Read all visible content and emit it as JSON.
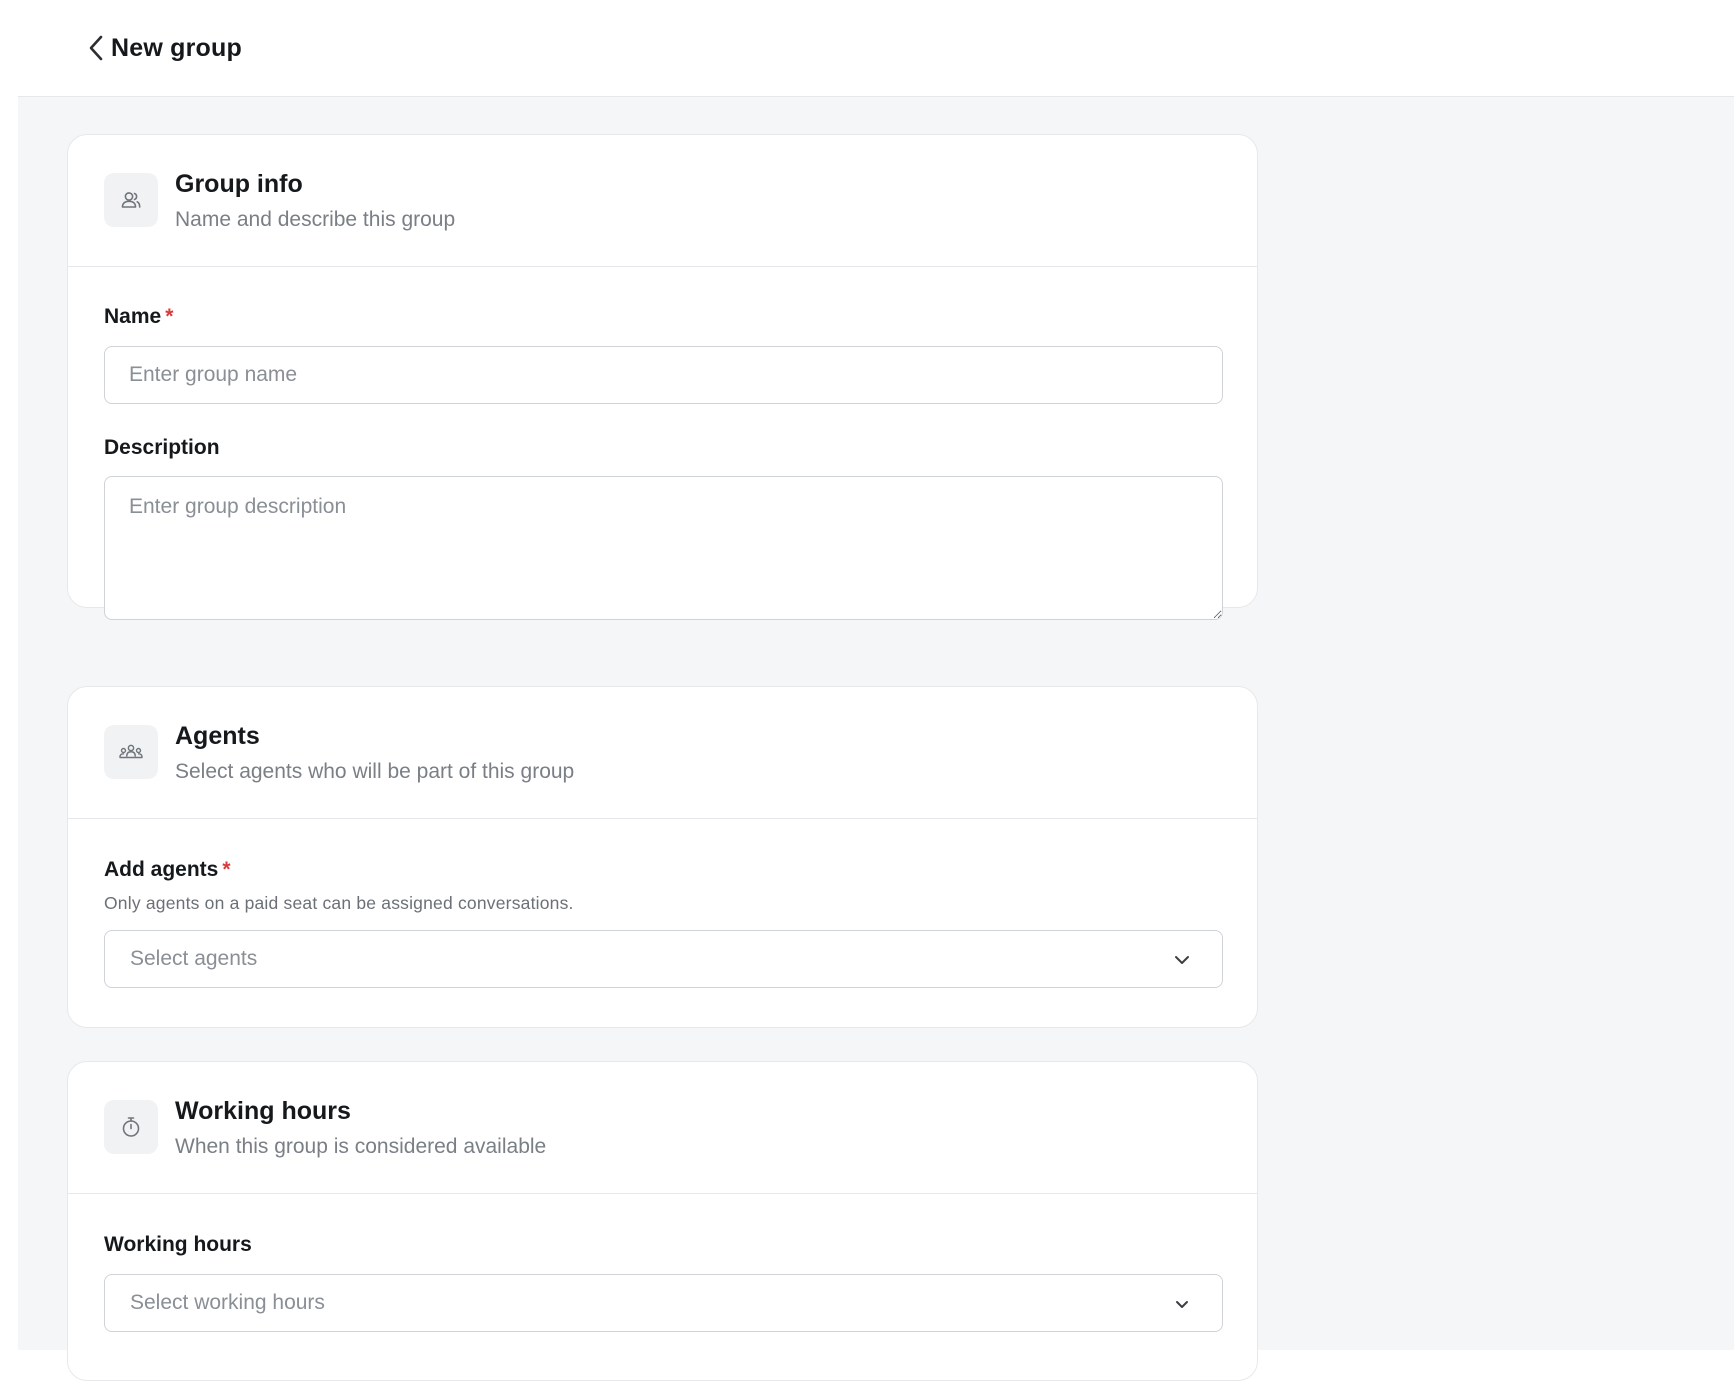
{
  "header": {
    "title": "New group",
    "back_icon": "chevron-left-icon"
  },
  "group_info": {
    "icon": "users-icon",
    "title": "Group info",
    "subtitle": "Name and describe this group",
    "name_label": "Name",
    "required_mark": "*",
    "name_placeholder": "Enter group name",
    "name_value": "",
    "description_label": "Description",
    "description_placeholder": "Enter group description",
    "description_value": ""
  },
  "agents": {
    "icon": "team-icon",
    "title": "Agents",
    "subtitle": "Select agents who will be part of this group",
    "add_label": "Add agents",
    "required_mark": "*",
    "help": "Only agents on a paid seat can be assigned conversations.",
    "select_placeholder": "Select agents"
  },
  "working_hours": {
    "icon": "stopwatch-icon",
    "title": "Working hours",
    "subtitle": "When this group is considered available",
    "field_label": "Working hours",
    "select_placeholder": "Select working hours"
  },
  "colors": {
    "required": "#d93a3a",
    "page_background": "#f5f6f7",
    "border": "#e6e8eb"
  }
}
